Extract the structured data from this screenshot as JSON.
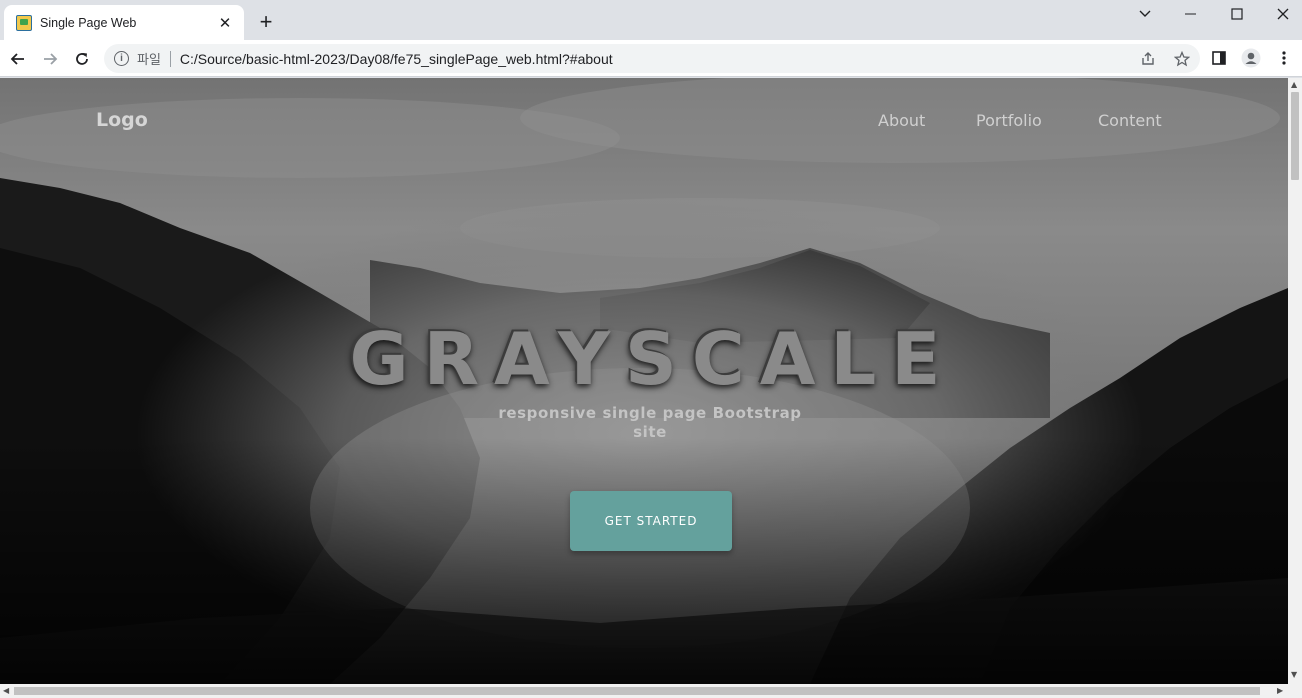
{
  "browser": {
    "tab": {
      "title": "Single Page Web",
      "close_glyph": "✕"
    },
    "new_tab_glyph": "+",
    "window_controls": {
      "dropdown_glyph": "⌄",
      "minimize_glyph": "—",
      "maximize_glyph": "☐",
      "close_glyph": "✕"
    },
    "address_bar": {
      "scheme_label": "파일",
      "url": "C:/Source/basic-html-2023/Day08/fe75_singlePage_web.html?#about",
      "info_glyph": "i"
    }
  },
  "page": {
    "logo": "Logo",
    "nav": [
      "About",
      "Portfolio",
      "Content"
    ],
    "hero": {
      "title": "GRAYSCALE",
      "subtitle": "responsive single page Bootstrap site",
      "cta_label": "GET STARTED",
      "cta_color": "#64a19d"
    }
  },
  "icons": [
    "back-icon",
    "forward-icon",
    "reload-icon",
    "info-icon",
    "share-icon",
    "star-icon",
    "side-panel-icon",
    "profile-icon",
    "menu-icon"
  ]
}
